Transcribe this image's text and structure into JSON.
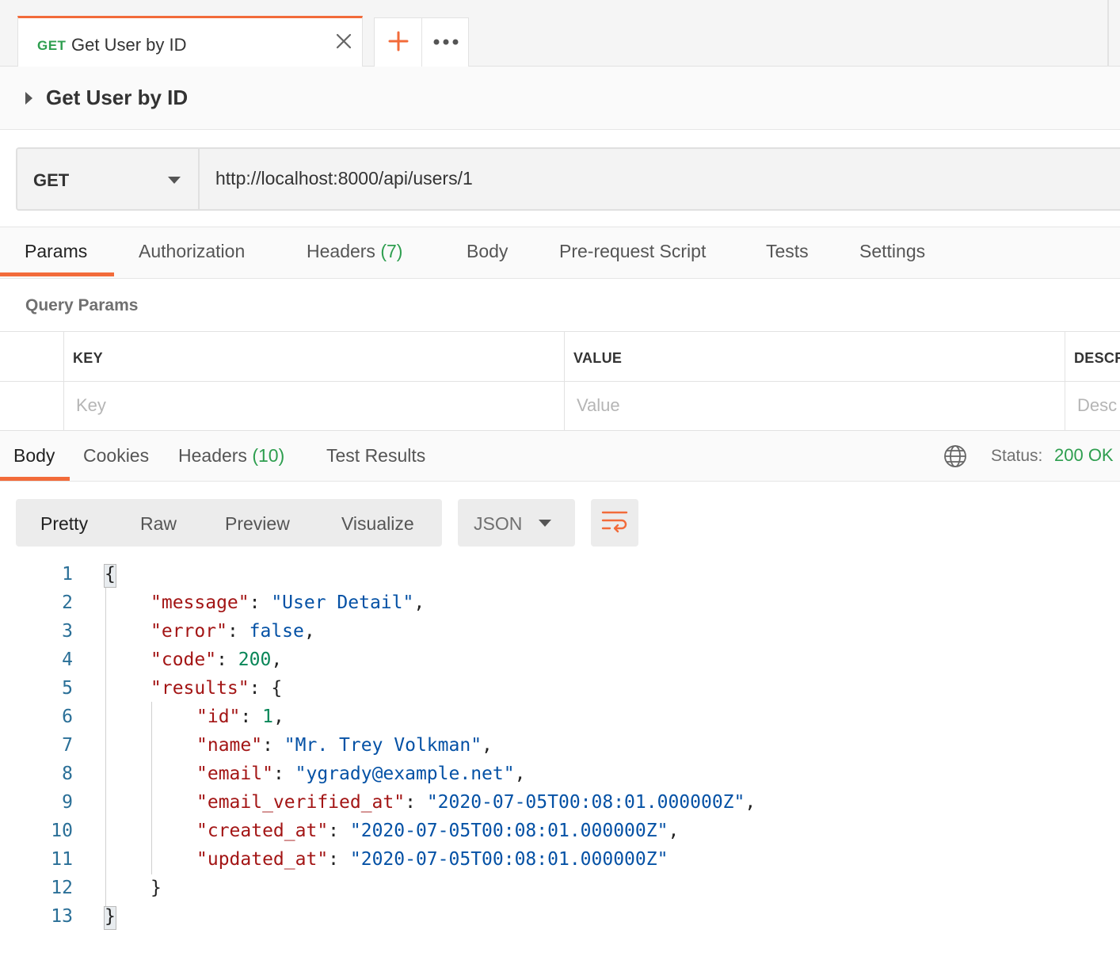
{
  "tab": {
    "method": "GET",
    "title": "Get User by ID"
  },
  "request": {
    "name": "Get User by ID",
    "method": "GET",
    "url": "http://localhost:8000/api/users/1"
  },
  "request_tabs": [
    {
      "label": "Params",
      "count": ""
    },
    {
      "label": "Authorization",
      "count": ""
    },
    {
      "label": "Headers",
      "count": "(7)"
    },
    {
      "label": "Body",
      "count": ""
    },
    {
      "label": "Pre-request Script",
      "count": ""
    },
    {
      "label": "Tests",
      "count": ""
    },
    {
      "label": "Settings",
      "count": ""
    }
  ],
  "query_params": {
    "title": "Query Params",
    "headers": [
      "KEY",
      "VALUE",
      "DESCR"
    ],
    "placeholders": [
      "Key",
      "Value",
      "Desc"
    ]
  },
  "response_tabs": [
    {
      "label": "Body",
      "count": ""
    },
    {
      "label": "Cookies",
      "count": ""
    },
    {
      "label": "Headers",
      "count": "(10)"
    },
    {
      "label": "Test Results",
      "count": ""
    }
  ],
  "status": {
    "label": "Status:",
    "value": "200 OK"
  },
  "view_modes": [
    "Pretty",
    "Raw",
    "Preview",
    "Visualize"
  ],
  "format": "JSON",
  "colors": {
    "accent": "#f26b3a",
    "success": "#2e9e4f",
    "json_key": "#a31515",
    "json_string": "#0451a5",
    "json_number": "#098658",
    "line_number": "#2a6f97"
  },
  "icons": {
    "close": "close-icon",
    "add": "plus-icon",
    "more": "more-dots-icon",
    "expand": "caret-right-icon",
    "dropdown": "chevron-down-icon",
    "network": "globe-icon",
    "wrap": "wrap-lines-icon"
  },
  "code": {
    "line_numbers": [
      "1",
      "2",
      "3",
      "4",
      "5",
      "6",
      "7",
      "8",
      "9",
      "10",
      "11",
      "12",
      "13"
    ],
    "lines": [
      [
        {
          "t": "{",
          "c": "p"
        }
      ],
      [
        {
          "t": "\"message\"",
          "c": "k"
        },
        {
          "t": ": ",
          "c": "p"
        },
        {
          "t": "\"User Detail\"",
          "c": "s"
        },
        {
          "t": ",",
          "c": "p"
        }
      ],
      [
        {
          "t": "\"error\"",
          "c": "k"
        },
        {
          "t": ": ",
          "c": "p"
        },
        {
          "t": "false",
          "c": "b"
        },
        {
          "t": ",",
          "c": "p"
        }
      ],
      [
        {
          "t": "\"code\"",
          "c": "k"
        },
        {
          "t": ": ",
          "c": "p"
        },
        {
          "t": "200",
          "c": "n"
        },
        {
          "t": ",",
          "c": "p"
        }
      ],
      [
        {
          "t": "\"results\"",
          "c": "k"
        },
        {
          "t": ": {",
          "c": "p"
        }
      ],
      [
        {
          "t": "\"id\"",
          "c": "k"
        },
        {
          "t": ": ",
          "c": "p"
        },
        {
          "t": "1",
          "c": "n"
        },
        {
          "t": ",",
          "c": "p"
        }
      ],
      [
        {
          "t": "\"name\"",
          "c": "k"
        },
        {
          "t": ": ",
          "c": "p"
        },
        {
          "t": "\"Mr. Trey Volkman\"",
          "c": "s"
        },
        {
          "t": ",",
          "c": "p"
        }
      ],
      [
        {
          "t": "\"email\"",
          "c": "k"
        },
        {
          "t": ": ",
          "c": "p"
        },
        {
          "t": "\"ygrady@example.net\"",
          "c": "s"
        },
        {
          "t": ",",
          "c": "p"
        }
      ],
      [
        {
          "t": "\"email_verified_at\"",
          "c": "k"
        },
        {
          "t": ": ",
          "c": "p"
        },
        {
          "t": "\"2020-07-05T00:08:01.000000Z\"",
          "c": "s"
        },
        {
          "t": ",",
          "c": "p"
        }
      ],
      [
        {
          "t": "\"created_at\"",
          "c": "k"
        },
        {
          "t": ": ",
          "c": "p"
        },
        {
          "t": "\"2020-07-05T00:08:01.000000Z\"",
          "c": "s"
        },
        {
          "t": ",",
          "c": "p"
        }
      ],
      [
        {
          "t": "\"updated_at\"",
          "c": "k"
        },
        {
          "t": ": ",
          "c": "p"
        },
        {
          "t": "\"2020-07-05T00:08:01.000000Z\"",
          "c": "s"
        }
      ],
      [
        {
          "t": "}",
          "c": "p"
        }
      ],
      [
        {
          "t": "}",
          "c": "p"
        }
      ]
    ]
  }
}
